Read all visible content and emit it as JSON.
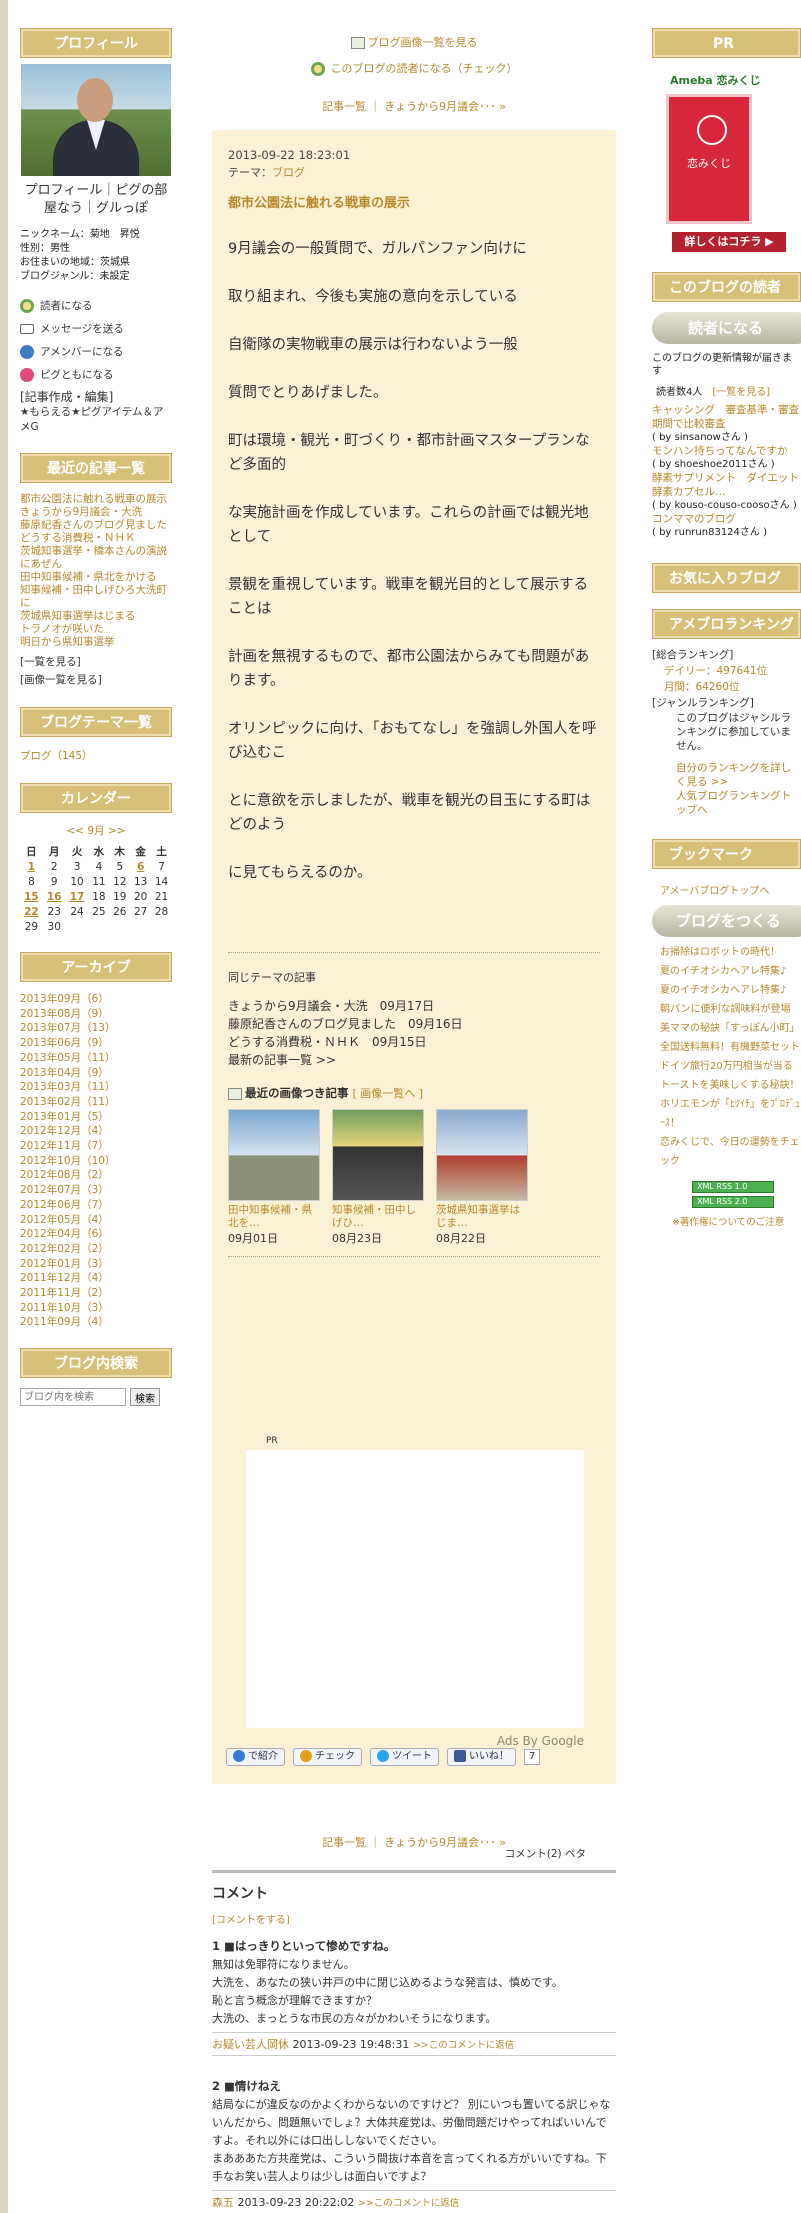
{
  "left": {
    "profile_title": "プロフィール",
    "profile_name": "プロフィール｜ピグの部屋なう｜グルっぽ",
    "profile_lines": [
      "ニックネーム：菊地　昇悦",
      "性別：男性",
      "お住まいの地域：茨城県",
      "ブログジャンル：未設定"
    ],
    "actions": [
      "読者になる",
      "メッセージを送る",
      "アメンバーになる",
      "ピグともになる"
    ],
    "edit_label": "[記事作成・編集]",
    "edit_sub": "★もらえる★ピグアイテム＆アメG",
    "recent_title": "最近の記事一覧",
    "recent_items": [
      "都市公園法に触れる戦車の展示",
      "きょうから9月議会・大洗",
      "藤原紀香さんのブログ見ました",
      "どうする消費税・ＮＨＫ",
      "茨城知事選挙・橋本さんの演説にあぜん",
      "田中知事候補・県北をかける",
      "知事候補・田中しげひろ大洗町に",
      "茨城県知事選挙はじまる",
      "トラノオが咲いた",
      "明日から県知事選挙"
    ],
    "recent_more": "[一覧を見る]",
    "recent_img": "[画像一覧を見る]",
    "theme_title": "ブログテーマ一覧",
    "theme_item": "ブログ（145）",
    "calendar_title": "カレンダー",
    "cal_nav": "<< 9月 >>",
    "cal_days": [
      "日",
      "月",
      "火",
      "水",
      "木",
      "金",
      "土"
    ],
    "cal_rows": [
      [
        "1",
        "2",
        "3",
        "4",
        "5",
        "6",
        "7"
      ],
      [
        "8",
        "9",
        "10",
        "11",
        "12",
        "13",
        "14"
      ],
      [
        "15",
        "16",
        "17",
        "18",
        "19",
        "20",
        "21"
      ],
      [
        "22",
        "23",
        "24",
        "25",
        "26",
        "27",
        "28"
      ],
      [
        "29",
        "30",
        "",
        "",
        "",
        "",
        ""
      ]
    ],
    "archive_title": "アーカイブ",
    "archives": [
      "2013年09月（6）",
      "2013年08月（9）",
      "2013年07月（13）",
      "2013年06月（9）",
      "2013年05月（11）",
      "2013年04月（9）",
      "2013年03月（11）",
      "2013年02月（11）",
      "2013年01月（5）",
      "2012年12月（4）",
      "2012年11月（7）",
      "2012年10月（10）",
      "2012年08月（2）",
      "2012年07月（3）",
      "2012年06月（7）",
      "2012年05月（4）",
      "2012年04月（6）",
      "2012年02月（2）",
      "2012年01月（3）",
      "2011年12月（4）",
      "2011年11月（2）",
      "2011年10月（3）",
      "2011年09月（4）"
    ],
    "search_title": "ブログ内検索",
    "search_placeholder": "ブログ内を検索",
    "search_button": "検索"
  },
  "center": {
    "img_list_link": "ブログ画像一覧を見る",
    "reader_link": "このブログの読者になる（チェック）",
    "top_nav": "記事一覧 ｜ きょうから9月議会･･･ »",
    "date": "2013-09-22 18:23:01",
    "theme_label": "テーマ：",
    "theme": "ブログ",
    "title": "都市公園法に触れる戦車の展示",
    "paragraphs": [
      "9月議会の一般質問で、ガルパンファン向けに",
      "取り組まれ、今後も実施の意向を示している",
      "自衛隊の実物戦車の展示は行わないよう一般",
      "質問でとりあげました。",
      "町は環境・観光・町づくり・都市計画マスタープランなど多面的",
      "な実施計画を作成しています。これらの計画では観光地として",
      "景観を重視しています。戦車を観光目的として展示することは",
      "計画を無視するもので、都市公園法からみても問題があります。",
      "オリンピックに向け、「おもてなし」を強調し外国人を呼び込むこ",
      "とに意欲を示しましたが、戦車を観光の目玉にする町はどのよう",
      "に見てもらえるのか。"
    ],
    "related_title": "同じテーマの記事",
    "related": [
      "きょうから9月議会・大洗　09月17日",
      "藤原紀香さんのブログ見ました　09月16日",
      "どうする消費税・ＮＨＫ　09月15日",
      "最新の記事一覧 >>"
    ],
    "recent_img_title": "最近の画像つき記事",
    "recent_img_link": "[ 画像一覧へ ]",
    "thumbs": [
      {
        "cap": "田中知事候補・県北を…",
        "date": "09月01日"
      },
      {
        "cap": "知事候補・田中しげひ…",
        "date": "08月23日"
      },
      {
        "cap": "茨城県知事選挙はじま…",
        "date": "08月22日"
      }
    ],
    "pr": "PR",
    "ads": "Ads By Google",
    "social": [
      "で紹介",
      "チェック",
      "ツイート",
      "いいね！"
    ],
    "like_count": "7",
    "entry_bottom": "コメント(2)  ペタ",
    "foot_nav": "記事一覧 ｜ きょうから9月議会･･･ »",
    "comments_title": "コメント",
    "comment_add": "[コメントをする]",
    "comments": [
      {
        "title": "1 ■はっきりといって惨めですね。",
        "body": [
          "無知は免罪符になりません。",
          "大洗を、あなたの狭い井戸の中に閉じ込めるような発言は、慎めです。",
          "恥と言う概念が理解できますか？",
          "大洗の、まっとうな市民の方々がかわいそうになります。"
        ],
        "author": "お疑い芸人岡休",
        "time": "2013-09-23 19:48:31",
        "reply": ">>このコメントに返信"
      },
      {
        "title": "2 ■情けねえ",
        "body": [
          "結局なにが違反なのかよくわからないのですけど？ 別にいつも置いてる訳じゃないんだから、問題無いでしょ？大体共産党は、労働問題だけやってればいいんですよ。それ以外には口出ししないでください。",
          "まあああた方共産党は、こういう間抜け本音を言ってくれる方がいいですね。下手なお笑い芸人よりは少しは面白いですよ？"
        ],
        "author": "森五",
        "time": "2013-09-23 20:22:02",
        "reply": ">>このコメントに返信"
      }
    ]
  },
  "right": {
    "pr_title": "PR",
    "ameba_logo": "Ameba 恋みくじ",
    "omikuji": "恋みくじ",
    "detail_btn": "詳しくはコチラ ▶",
    "readers_title": "このブログの読者",
    "reader_btn": "読者になる",
    "update_txt": "このブログの更新情報が届きます",
    "reader_count": "読者数4人",
    "reader_list_link": "[一覧を見る]",
    "readers": [
      {
        "name": "キャッシング　審査基準・審査期間で比較審査",
        "by": "( by sinsanowさん )"
      },
      {
        "name": "モンハン持ちってなんですか",
        "by": "( by shoeshoe2011さん )"
      },
      {
        "name": "酵素サプリメント　ダイエット酵素カプセル…",
        "by": "( by kouso-couso-coosoさん )"
      },
      {
        "name": "コンママのブログ",
        "by": "( by runrun83124さん )"
      }
    ],
    "fav_title": "お気に入りブログ",
    "ranking_title": "アメブロランキング",
    "rank_total": "[総合ランキング]",
    "rank_daily": "デイリー：497641位",
    "rank_monthly": "月間：64260位",
    "rank_genre": "[ジャンルランキング]",
    "rank_genre_txt": "このブログはジャンルランキングに参加していません。",
    "rank_self": "自分のランキングを詳しく見る >>",
    "rank_popular": "人気ブログランキングトップへ",
    "bookmark_title": "ブックマーク",
    "bookmark_link": "アメーバブログトップへ",
    "make_btn": "ブログをつくる",
    "ad_links": [
      "お掃除はロボットの時代！",
      "夏のイチオシカヘアレ特集♪",
      "夏のイチオシカヘアレ特集♪",
      "朝パンに便利な調味料が登場",
      "美ママの秘訣「すっぽん小町」",
      "全国送料無料！有機野菜セット",
      "ドイツ旅行20万円相当が当る",
      "トーストを美味しくする秘訣！",
      "ホリエモンが「ﾋﾂｲﾁ」をﾌﾟﾛﾃﾞｭｰｽ！",
      "恋みくじで、今日の運勢をチェック"
    ],
    "rss": [
      "XML RSS 1.0",
      "XML RSS 2.0"
    ],
    "copyright_note": "※著作権についてのご注意"
  }
}
